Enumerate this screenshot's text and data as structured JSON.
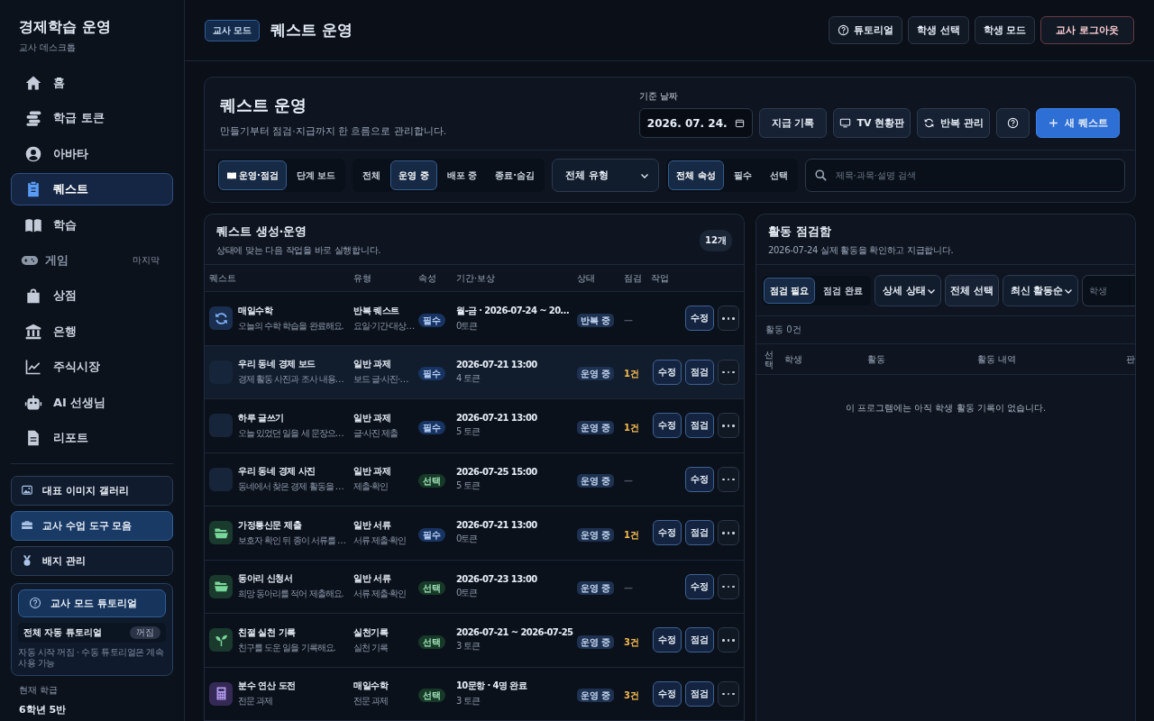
{
  "sidebar": {
    "title": "경제학습 운영",
    "subtitle": "교사 데스크톱",
    "nav": [
      {
        "label": "홈",
        "selected": false,
        "disabled": false
      },
      {
        "label": "학급 토큰",
        "selected": false,
        "disabled": false
      },
      {
        "label": "아바타",
        "selected": false,
        "disabled": false
      },
      {
        "label": "퀘스트",
        "selected": true,
        "disabled": false
      },
      {
        "label": "학습",
        "selected": false,
        "disabled": false
      },
      {
        "label": "게임",
        "selected": false,
        "disabled": true,
        "badge": "마지막"
      },
      {
        "label": "상점",
        "selected": false,
        "disabled": false
      },
      {
        "label": "은행",
        "selected": false,
        "disabled": false
      },
      {
        "label": "주식시장",
        "selected": false,
        "disabled": false
      },
      {
        "label": "AI 선생님",
        "selected": false,
        "disabled": false
      },
      {
        "label": "리포트",
        "selected": false,
        "disabled": false
      }
    ],
    "tools": [
      {
        "label": "대표 이미지 갤러리",
        "selected": false
      },
      {
        "label": "교사 수업 도구 모음",
        "selected": true
      },
      {
        "label": "배지 관리",
        "selected": false
      }
    ],
    "tutorial": {
      "button": "교사 모드 튜토리얼",
      "auto_label": "전체 자동 튜토리얼",
      "auto_on": false,
      "auto_state": "꺼짐",
      "note": "자동 시작 꺼짐 · 수동 튜토리얼은 계속 사용 가능"
    },
    "class_label": "현재 학급",
    "class_name": "6학년 5반"
  },
  "header": {
    "mode_badge": "교사 모드",
    "title": "퀘스트 운영",
    "buttons": [
      {
        "label": "튜토리얼",
        "kind": "help"
      },
      {
        "label": "학생 선택",
        "kind": "plain"
      },
      {
        "label": "학생 모드",
        "kind": "plain"
      },
      {
        "label": "교사 로그아웃",
        "kind": "danger"
      }
    ]
  },
  "overview": {
    "title": "퀘스트 운영",
    "subtitle": "만들기부터 점검·지급까지 한 흐름으로 관리합니다.",
    "date_label": "기준 날짜",
    "date_value": "2026. 07. 24.",
    "buttons": [
      {
        "label": "지급 기록",
        "kind": "plain"
      },
      {
        "label": "TV 현황판",
        "kind": "monitor"
      },
      {
        "label": "반복 관리",
        "kind": "repeat"
      },
      {
        "kind": "help"
      },
      {
        "label": "새 퀘스트",
        "kind": "primary"
      }
    ],
    "view_tabs": [
      {
        "label": "운영·점검",
        "selected": true
      },
      {
        "label": "단계 보드",
        "selected": false
      }
    ],
    "status_tabs": [
      {
        "label": "전체",
        "selected": false
      },
      {
        "label": "운영 중",
        "selected": true
      },
      {
        "label": "배포 중",
        "selected": false
      },
      {
        "label": "종료·숨김",
        "selected": false
      }
    ],
    "type_select": "전체 유형",
    "attr_tabs": [
      {
        "label": "전체 속성",
        "selected": true
      },
      {
        "label": "필수",
        "selected": false
      },
      {
        "label": "선택",
        "selected": false
      }
    ],
    "search_placeholder": "제목·과목·설명 검색"
  },
  "quests": {
    "title": "퀘스트 생성·운영",
    "subtitle": "상태에 맞는 다음 작업을 바로 실행합니다.",
    "count": "12개",
    "columns": [
      "퀘스트",
      "유형",
      "속성",
      "기간·보상",
      "상태",
      "점검",
      "작업"
    ],
    "rows": [
      {
        "title": "매일수학",
        "desc": "오늘의 수학 학습을 완료해요.",
        "type": "반복 퀘스트",
        "type_sub": "요일·기간·대상…",
        "attribute": "필수",
        "required": true,
        "period": "월-금 · 2026-07-24 ~ 20…",
        "reward": "0토큰",
        "status": "반복 중",
        "check": "—",
        "pending": false,
        "actions": [
          "수정"
        ],
        "selected": false
      },
      {
        "title": "우리 동네 경제 보드",
        "desc": "경제 활동 사진과 조사 내용…",
        "type": "일반 과제",
        "type_sub": "보드 글·사진·…",
        "attribute": "필수",
        "required": true,
        "period": "2026-07-21 13:00",
        "reward": "4 토큰",
        "status": "운영 중",
        "check": "1건",
        "pending": true,
        "actions": [
          "수정",
          "점검"
        ],
        "selected": true
      },
      {
        "title": "하루 글쓰기",
        "desc": "오늘 있었던 일을 세 문장으…",
        "type": "일반 과제",
        "type_sub": "글·사진 제출",
        "attribute": "필수",
        "required": true,
        "period": "2026-07-21 13:00",
        "reward": "5 토큰",
        "status": "운영 중",
        "check": "1건",
        "pending": true,
        "actions": [
          "수정",
          "점검"
        ],
        "selected": false
      },
      {
        "title": "우리 동네 경제 사진",
        "desc": "동네에서 찾은 경제 활동을 …",
        "type": "일반 과제",
        "type_sub": "제출·확인",
        "attribute": "선택",
        "required": false,
        "period": "2026-07-25 15:00",
        "reward": "5 토큰",
        "status": "운영 중",
        "check": "—",
        "pending": false,
        "actions": [
          "수정"
        ],
        "selected": false
      },
      {
        "title": "가정통신문 제출",
        "desc": "보호자 확인 뒤 종이 서류를 …",
        "type": "일반 서류",
        "type_sub": "서류 제출·확인",
        "attribute": "필수",
        "required": true,
        "period": "2026-07-21 13:00",
        "reward": "0토큰",
        "status": "운영 중",
        "check": "1건",
        "pending": true,
        "actions": [
          "수정",
          "점검"
        ],
        "selected": false
      },
      {
        "title": "동아리 신청서",
        "desc": "희망 동아리를 적어 제출해요.",
        "type": "일반 서류",
        "type_sub": "서류 제출·확인",
        "attribute": "선택",
        "required": false,
        "period": "2026-07-23 13:00",
        "reward": "0토큰",
        "status": "운영 중",
        "check": "—",
        "pending": false,
        "actions": [
          "수정"
        ],
        "selected": false
      },
      {
        "title": "친절 실천 기록",
        "desc": "친구를 도운 일을 기록해요.",
        "type": "실천기록",
        "type_sub": "실천 기록",
        "attribute": "선택",
        "required": false,
        "period": "2026-07-21 ~ 2026-07-25",
        "reward": "3 토큰",
        "status": "운영 중",
        "check": "3건",
        "pending": true,
        "actions": [
          "수정",
          "점검"
        ],
        "selected": false
      },
      {
        "title": "분수 연산 도전",
        "desc": "전문 과제",
        "type": "매일수학",
        "type_sub": "전문 과제",
        "attribute": "선택",
        "required": false,
        "period": "10문항 · 4명 완료",
        "reward": "3 토큰",
        "status": "운영 중",
        "check": "3건",
        "pending": true,
        "actions": [
          "수정",
          "점검"
        ],
        "selected": false
      }
    ]
  },
  "review": {
    "title": "활동 점검함",
    "subtitle": "2026-07-24 실제 활동을 확인하고 지급합니다.",
    "tabs": [
      {
        "label": "점검 필요",
        "selected": true
      },
      {
        "label": "점검 완료",
        "selected": false
      }
    ],
    "status_select": "상세 상태",
    "select_all": "전체 선택",
    "sort_select": "최신 활동순",
    "student_placeholder": "학생",
    "count": "활동 0건",
    "columns": [
      "선택",
      "학생",
      "활동",
      "활동 내역",
      "판"
    ],
    "empty": "이 프로그램에는 아직 학생 활동 기록이 없습니다."
  }
}
